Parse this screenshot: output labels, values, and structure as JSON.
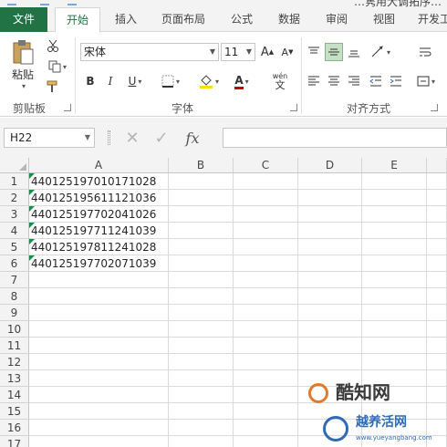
{
  "title_fragment": "…隽用大调拓序…",
  "tabs": [
    "文件",
    "开始",
    "插入",
    "页面布局",
    "公式",
    "数据",
    "审阅",
    "视图",
    "开发工"
  ],
  "active_tab": "开始",
  "clipboard": {
    "paste_label": "粘贴",
    "group_label": "剪贴板"
  },
  "font": {
    "name": "宋体",
    "size": "11",
    "group_label": "字体",
    "bold": "B",
    "italic": "I",
    "underline": "U",
    "grow": "A",
    "shrink": "A",
    "color_a": "A",
    "wen_top": "wén",
    "wen_bottom": "文"
  },
  "alignment": {
    "group_label": "对齐方式"
  },
  "formula_bar": {
    "name_box": "H22",
    "fx": "fx",
    "formula": ""
  },
  "columns": [
    "A",
    "B",
    "C",
    "D",
    "E"
  ],
  "rows": [
    "1",
    "2",
    "3",
    "4",
    "5",
    "6",
    "7",
    "8",
    "9",
    "10",
    "11",
    "12",
    "13",
    "14",
    "15",
    "16",
    "17"
  ],
  "cells_a": [
    "440125197010171028",
    "440125195611121036",
    "440125197702041026",
    "440125197711241039",
    "440125197811241028",
    "440125197702071039"
  ],
  "colors": {
    "accent": "#217346",
    "header_bg": "#f3f3f3",
    "error_marker": "#1b8a4b",
    "font_color": "#c00000",
    "fill_color": "#f5e100"
  },
  "watermark": {
    "brand": "酷知网",
    "brand2": "越养活网",
    "url": "www.yueyangbang.com"
  }
}
